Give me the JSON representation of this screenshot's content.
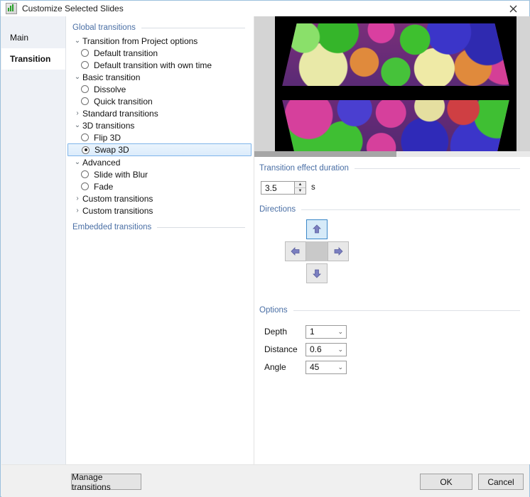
{
  "window": {
    "title": "Customize Selected Slides",
    "app_icon": "chart-green-icon",
    "close_icon": "close-icon"
  },
  "tabs": [
    {
      "label": "Main",
      "selected": false
    },
    {
      "label": "Transition",
      "selected": true
    }
  ],
  "tree": {
    "section_global": "Global transitions",
    "section_embedded": "Embedded transitions",
    "nodes": [
      {
        "label": "Transition from Project options",
        "type": "group",
        "state": "expanded"
      },
      {
        "label": "Default transition",
        "type": "radio",
        "checked": false
      },
      {
        "label": "Default transition with own time",
        "type": "radio",
        "checked": false
      },
      {
        "label": "Basic transition",
        "type": "group",
        "state": "expanded"
      },
      {
        "label": "Dissolve",
        "type": "radio",
        "checked": false
      },
      {
        "label": "Quick transition",
        "type": "radio",
        "checked": false
      },
      {
        "label": "Standard transitions",
        "type": "group",
        "state": "collapsed"
      },
      {
        "label": "3D transitions",
        "type": "group",
        "state": "expanded"
      },
      {
        "label": "Flip 3D",
        "type": "radio",
        "checked": false
      },
      {
        "label": "Swap 3D",
        "type": "radio",
        "checked": true,
        "selected": true
      },
      {
        "label": "Advanced",
        "type": "group",
        "state": "expanded"
      },
      {
        "label": "Slide with Blur",
        "type": "radio",
        "checked": false
      },
      {
        "label": "Fade",
        "type": "radio",
        "checked": false
      },
      {
        "label": "Custom transitions",
        "type": "group",
        "state": "collapsed"
      },
      {
        "label": "Custom transitions",
        "type": "group",
        "state": "collapsed"
      }
    ],
    "chevron_expanded": "⌄",
    "chevron_collapsed": "›"
  },
  "preview": {
    "alt": "balloons-transition-preview",
    "scrollbar": "horizontal-scrollbar"
  },
  "duration": {
    "section_label": "Transition effect duration",
    "value": "3.5",
    "unit": "s",
    "spin_up_icon": "spin-up-icon",
    "spin_down_icon": "spin-down-icon"
  },
  "directions": {
    "section_label": "Directions",
    "buttons": [
      {
        "name": "direction-up",
        "icon": "arrow-up-icon",
        "selected": true
      },
      {
        "name": "direction-left",
        "icon": "arrow-left-icon",
        "selected": false
      },
      {
        "name": "direction-center",
        "icon": "",
        "selected": false
      },
      {
        "name": "direction-right",
        "icon": "arrow-right-icon",
        "selected": false
      },
      {
        "name": "direction-down",
        "icon": "arrow-down-icon",
        "selected": false
      }
    ]
  },
  "options": {
    "section_label": "Options",
    "rows": [
      {
        "label": "Depth",
        "value": "1"
      },
      {
        "label": "Distance",
        "value": "0.6"
      },
      {
        "label": "Angle",
        "value": "45"
      }
    ],
    "dropdown_icon": "chevron-down-icon"
  },
  "footer": {
    "manage": "Manage transitions",
    "ok": "OK",
    "cancel": "Cancel"
  },
  "colors": {
    "accent_blue": "#4a6fa5",
    "selection_border": "#7eb4ea",
    "selection_bg": "#dcecfb",
    "dpad_selected_border": "#3a87c8",
    "dpad_selected_bg": "#d6eaf8",
    "arrow_fill": "#7b7fc0",
    "window_border": "#9bc0dd"
  }
}
